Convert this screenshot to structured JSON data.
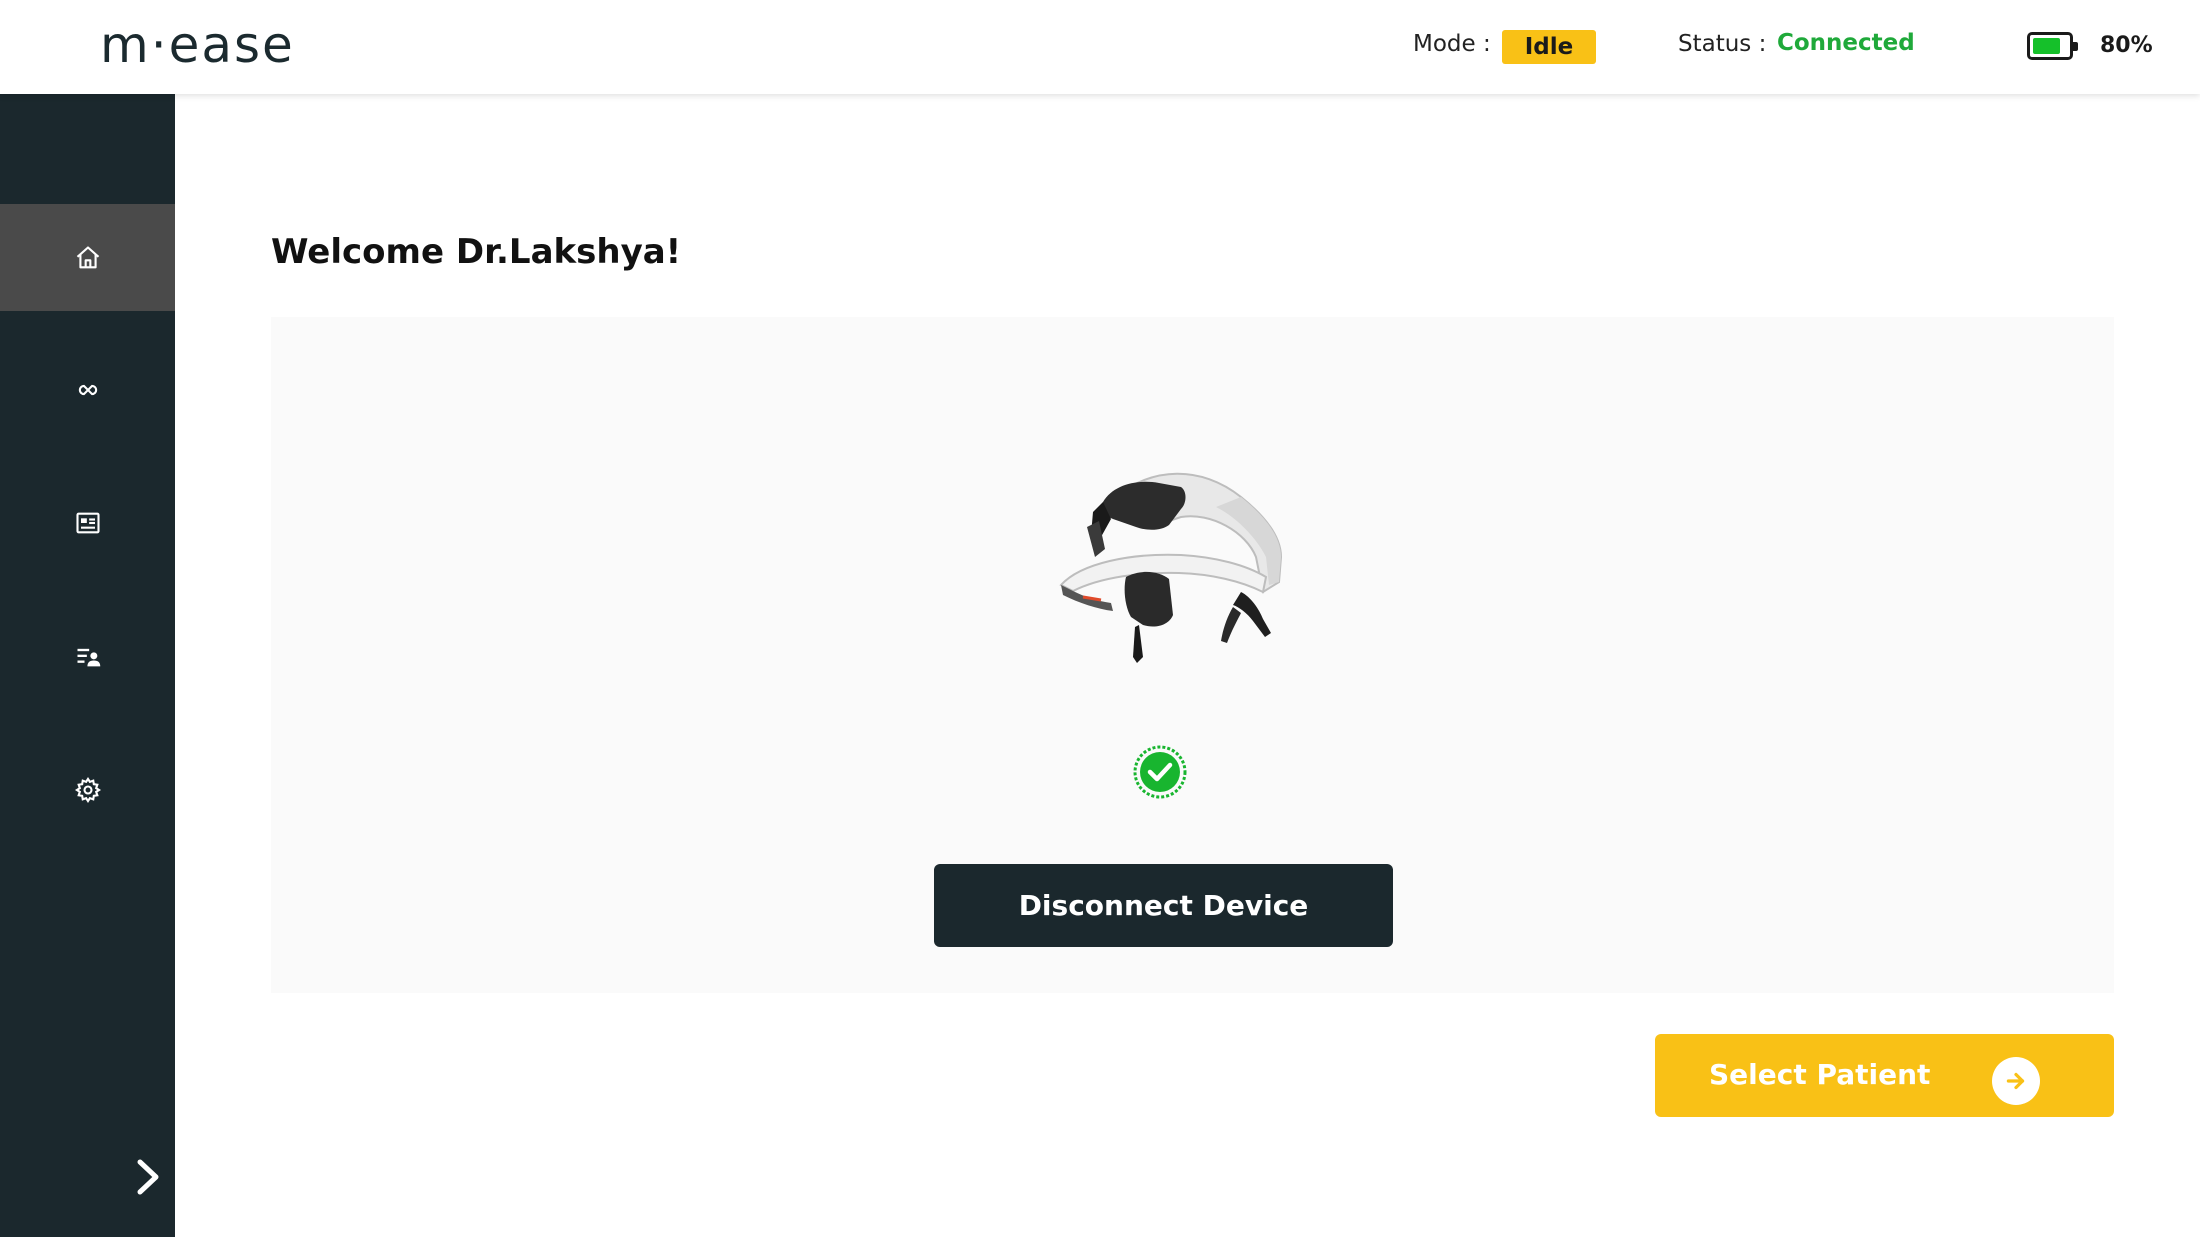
{
  "app": {
    "logo": "m·ease"
  },
  "header": {
    "mode_label": "Mode :",
    "mode_value": "Idle",
    "status_label": "Status :",
    "status_value": "Connected",
    "battery_percent": "80%",
    "battery_level": 0.8
  },
  "sidebar": {
    "items": [
      {
        "name": "home",
        "icon": "home-icon",
        "active": true
      },
      {
        "name": "link",
        "icon": "infinity-icon",
        "active": false
      },
      {
        "name": "reports",
        "icon": "report-card-icon",
        "active": false
      },
      {
        "name": "patients",
        "icon": "patient-list-icon",
        "active": false
      },
      {
        "name": "settings",
        "icon": "gear-icon",
        "active": false
      }
    ],
    "collapse_icon": "chevron-right-icon"
  },
  "main": {
    "welcome": "Welcome Dr.Lakshya!",
    "device_icon": "headset-device-image",
    "connection_icon": "check-badge-icon",
    "disconnect_label": "Disconnect Device",
    "select_patient_label": "Select Patient",
    "select_patient_icon": "arrow-right-circle-icon"
  },
  "colors": {
    "sidebar_bg": "#1b282d",
    "accent_yellow": "#f9c116",
    "status_green": "#1fa93a",
    "battery_green": "#15c02a"
  }
}
